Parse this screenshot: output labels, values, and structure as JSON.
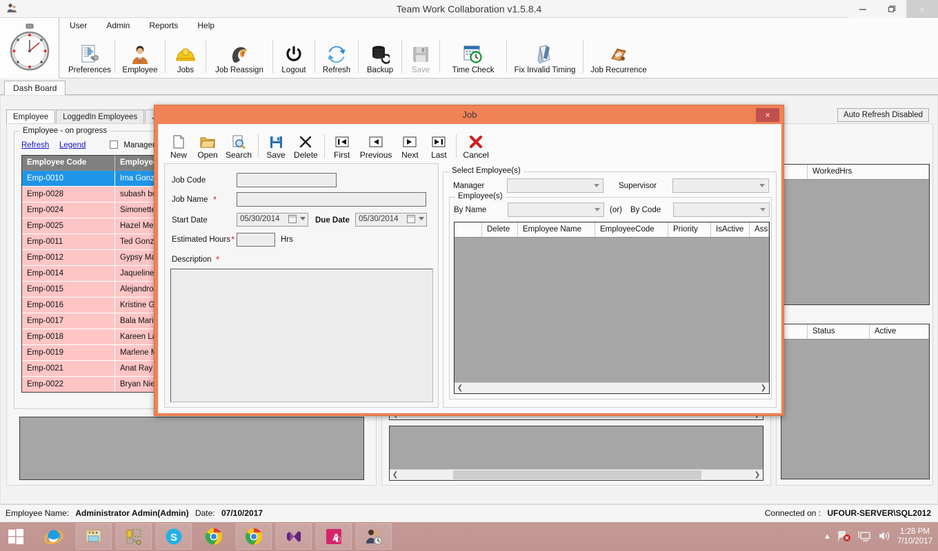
{
  "window": {
    "title": "Team Work Collaboration v1.5.8.4",
    "app_icon": "user-app-icon",
    "minimize": "–",
    "restore": "❐",
    "close": "×"
  },
  "menu": {
    "items": [
      {
        "label": "User",
        "name": "menu-user"
      },
      {
        "label": "Admin",
        "name": "menu-admin"
      },
      {
        "label": "Reports",
        "name": "menu-reports"
      },
      {
        "label": "Help",
        "name": "menu-help"
      }
    ]
  },
  "toolbar": {
    "buttons": [
      {
        "label": "Preferences",
        "icon": "preferences-icon"
      },
      {
        "label": "Employee",
        "icon": "employee-icon"
      },
      {
        "label": "Jobs",
        "icon": "hardhat-icon"
      },
      {
        "label": "Job Reassign",
        "icon": "job-reassign-icon"
      },
      {
        "label": "Logout",
        "icon": "power-icon"
      },
      {
        "label": "Refresh",
        "icon": "refresh-icon"
      },
      {
        "label": "Backup",
        "icon": "database-backup-icon"
      },
      {
        "label": "Save",
        "icon": "floppy-save-icon",
        "disabled": true
      },
      {
        "label": "Time Check",
        "icon": "calendar-clock-icon"
      },
      {
        "label": "Fix Invalid Timing",
        "icon": "fix-timing-icon"
      },
      {
        "label": "Job Recurrence",
        "icon": "job-recurrence-icon"
      }
    ]
  },
  "outer_tabs": [
    {
      "label": "Dash Board",
      "active": true
    }
  ],
  "dashboard": {
    "inner_tabs": [
      {
        "label": "Employee",
        "active": true
      },
      {
        "label": "LoggedIn Employees",
        "active": false
      },
      {
        "label": "Job Ass",
        "active": false
      }
    ],
    "auto_refresh_button": "Auto Refresh Disabled",
    "employee_group_title": "Employee - on progress",
    "links": [
      {
        "label": "Refresh",
        "name": "refresh-link"
      },
      {
        "label": "Legend",
        "name": "legend-link"
      }
    ],
    "checkboxes": [
      {
        "label": "Manager",
        "checked": false
      }
    ],
    "employee_grid": {
      "columns": [
        "Employee Code",
        "Employee"
      ],
      "rows": [
        {
          "code": "Emp-0010",
          "name": "Ima  Gonzale",
          "selected": true
        },
        {
          "code": "Emp-0028",
          "name": "subash  bose",
          "selected": false
        },
        {
          "code": "Emp-0024",
          "name": "Simonette  R",
          "selected": false
        },
        {
          "code": "Emp-0025",
          "name": "Hazel  Messin",
          "selected": false
        },
        {
          "code": "Emp-0011",
          "name": "Ted  Gonzale",
          "selected": false
        },
        {
          "code": "Emp-0012",
          "name": "Gypsy  Mace",
          "selected": false
        },
        {
          "code": "Emp-0014",
          "name": "Jaqueline  Ro",
          "selected": false
        },
        {
          "code": "Emp-0015",
          "name": "Alejandro  Ro",
          "selected": false
        },
        {
          "code": "Emp-0016",
          "name": "Kristine  Gutie",
          "selected": false
        },
        {
          "code": "Emp-0017",
          "name": "Bala  Marimut",
          "selected": false
        },
        {
          "code": "Emp-0018",
          "name": "Kareen  Lagri",
          "selected": false
        },
        {
          "code": "Emp-0019",
          "name": "Marlene  Mag",
          "selected": false
        },
        {
          "code": "Emp-0021",
          "name": "Anat  Ray",
          "selected": false
        },
        {
          "code": "Emp-0022",
          "name": "Bryan  Nierve",
          "selected": false
        }
      ]
    },
    "worked_grid": {
      "columns": [
        "WorkedHrs"
      ]
    },
    "status_grid": {
      "columns": [
        "Status",
        "Active"
      ]
    }
  },
  "dialog": {
    "title": "Job",
    "close_label": "×",
    "toolbar": [
      {
        "label": "New",
        "icon": "new-document-icon"
      },
      {
        "label": "Open",
        "icon": "open-folder-icon"
      },
      {
        "label": "Search",
        "icon": "search-icon"
      },
      {
        "label": "Save",
        "icon": "save-floppy-icon"
      },
      {
        "label": "Delete",
        "icon": "delete-x-icon"
      },
      {
        "label": "First",
        "icon": "first-record-icon"
      },
      {
        "label": "Previous",
        "icon": "previous-record-icon"
      },
      {
        "label": "Next",
        "icon": "next-record-icon"
      },
      {
        "label": "Last",
        "icon": "last-record-icon"
      },
      {
        "label": "Cancel",
        "icon": "cancel-x-icon"
      }
    ],
    "form": {
      "job_code_label": "Job Code",
      "job_code_value": "",
      "job_name_label": "Job Name",
      "job_name_value": "",
      "start_date_label": "Start Date",
      "start_date_value": "05/30/2014",
      "due_date_label": "Due Date",
      "due_date_value": "05/30/2014",
      "estimated_hours_label": "Estimated Hours",
      "estimated_hours_value": "",
      "hours_suffix": "Hrs",
      "description_label": "Description",
      "description_value": "",
      "required_marker": "*"
    },
    "select_employees": {
      "group_title": "Select Employee(s)",
      "manager_label": "Manager",
      "manager_value": "",
      "supervisor_label": "Supervisor",
      "supervisor_value": "",
      "employees_group_title": "Employee(s)",
      "by_name_label": "By Name",
      "by_name_value": "",
      "or_label": "(or)",
      "by_code_label": "By Code",
      "by_code_value": "",
      "grid_columns": [
        "",
        "Delete",
        "Employee Name",
        "EmployeeCode",
        "Priority",
        "IsActive",
        "Assign Date"
      ],
      "grid_rows": []
    }
  },
  "statusbar": {
    "employee_name_label": "Employee Name:",
    "employee_name_value": "Administrator  Admin(Admin)",
    "date_label": "Date:",
    "date_value": "07/10/2017",
    "connected_label": "Connected on :",
    "connected_value": "UFOUR-SERVER\\SQL2012"
  },
  "taskbar": {
    "start": "windows-start-icon",
    "buttons": [
      {
        "icon": "internet-explorer-icon"
      },
      {
        "icon": "file-explorer-icon"
      },
      {
        "icon": "sql-tools-icon"
      },
      {
        "icon": "skype-icon"
      },
      {
        "icon": "chrome-icon"
      },
      {
        "icon": "chrome-icon"
      },
      {
        "icon": "visual-studio-icon"
      },
      {
        "icon": "ms-access-icon"
      },
      {
        "icon": "teamwork-app-icon"
      }
    ],
    "tray": {
      "expand": "show-hidden-icons",
      "network": "network-error-icon",
      "monitor": "display-icon",
      "volume": "volume-icon",
      "time": "1:28 PM",
      "date": "7/10/2017"
    }
  },
  "colors": {
    "dialog_accent": "#f08256",
    "dialog_close": "#c0504d",
    "row_highlight": "#1f95e8",
    "row_pink": "#ffc5c5",
    "grid_empty": "#a6a6a6",
    "taskbar": "#c49a96"
  }
}
